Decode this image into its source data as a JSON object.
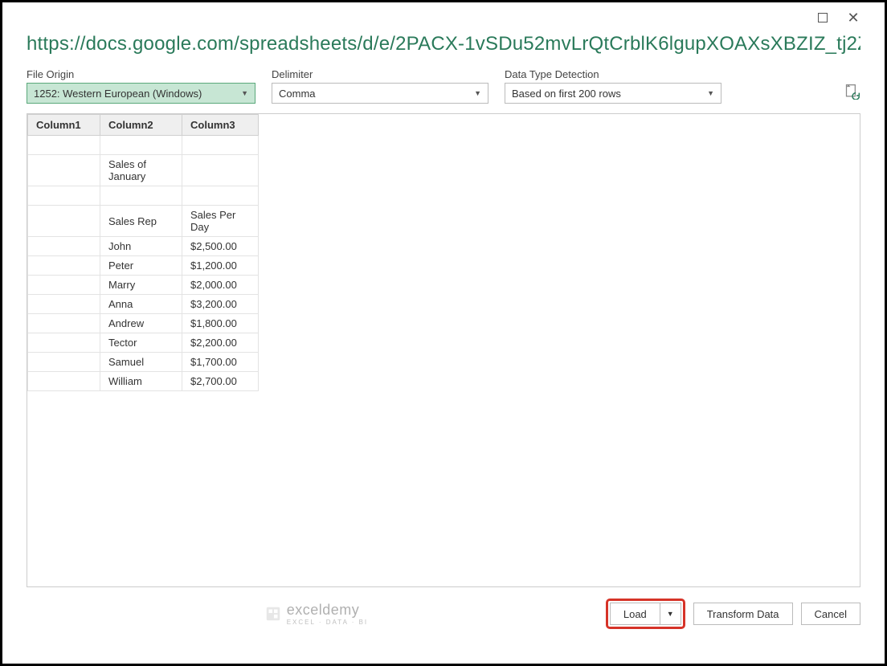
{
  "dialog": {
    "title_url": "https://docs.google.com/spreadsheets/d/e/2PACX-1vSDu52mvLrQtCrblK6lgupXOAXsXBZIZ_tj2Z..."
  },
  "controls": {
    "file_origin": {
      "label": "File Origin",
      "value": "1252: Western European (Windows)"
    },
    "delimiter": {
      "label": "Delimiter",
      "value": "Comma"
    },
    "data_type_detection": {
      "label": "Data Type Detection",
      "value": "Based on first 200 rows"
    }
  },
  "table": {
    "headers": [
      "Column1",
      "Column2",
      "Column3"
    ],
    "rows": [
      [
        "",
        "",
        ""
      ],
      [
        "",
        "Sales of January",
        ""
      ],
      [
        "",
        "",
        ""
      ],
      [
        "",
        "Sales Rep",
        "Sales Per Day"
      ],
      [
        "",
        "John",
        "$2,500.00"
      ],
      [
        "",
        "Peter",
        "$1,200.00"
      ],
      [
        "",
        "Marry",
        "$2,000.00"
      ],
      [
        "",
        "Anna",
        "$3,200.00"
      ],
      [
        "",
        "Andrew",
        "$1,800.00"
      ],
      [
        "",
        "Tector",
        "$2,200.00"
      ],
      [
        "",
        "Samuel",
        "$1,700.00"
      ],
      [
        "",
        "William",
        "$2,700.00"
      ]
    ]
  },
  "buttons": {
    "load": "Load",
    "transform": "Transform Data",
    "cancel": "Cancel"
  },
  "watermark": {
    "name": "exceldemy",
    "sub": "EXCEL · DATA · BI"
  }
}
